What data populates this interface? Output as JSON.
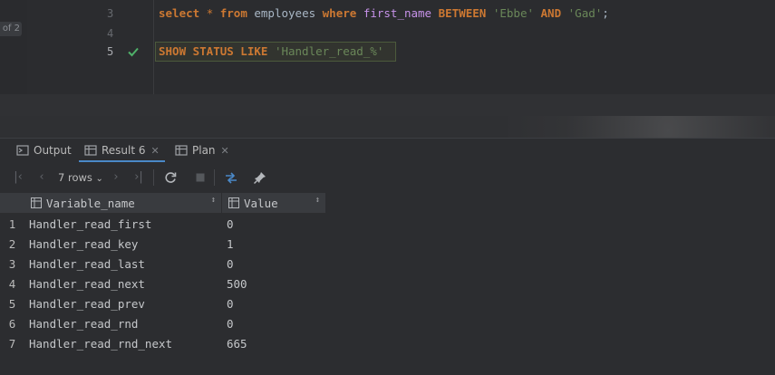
{
  "editor": {
    "page_indicator": "of 2",
    "lines": [
      {
        "num": "3",
        "tokens": [
          {
            "t": "select",
            "c": "kw"
          },
          {
            "t": " ",
            "c": "id"
          },
          {
            "t": "*",
            "c": "star"
          },
          {
            "t": " ",
            "c": "id"
          },
          {
            "t": "from",
            "c": "kw"
          },
          {
            "t": " employees ",
            "c": "id"
          },
          {
            "t": "where",
            "c": "kw"
          },
          {
            "t": " ",
            "c": "id"
          },
          {
            "t": "first_name",
            "c": "col"
          },
          {
            "t": " ",
            "c": "id"
          },
          {
            "t": "BETWEEN",
            "c": "kw"
          },
          {
            "t": " ",
            "c": "id"
          },
          {
            "t": "'Ebbe'",
            "c": "str"
          },
          {
            "t": " ",
            "c": "id"
          },
          {
            "t": "AND",
            "c": "kw"
          },
          {
            "t": " ",
            "c": "id"
          },
          {
            "t": "'Gad'",
            "c": "str"
          },
          {
            "t": ";",
            "c": "id"
          }
        ]
      },
      {
        "num": "4",
        "tokens": []
      },
      {
        "num": "5",
        "tokens": [
          {
            "t": "SHOW STATUS LIKE",
            "c": "kw"
          },
          {
            "t": " ",
            "c": "id"
          },
          {
            "t": "'Handler_read_%'",
            "c": "str"
          }
        ]
      }
    ]
  },
  "tool_window": {
    "tabs": [
      {
        "label": "Output",
        "icon": "output-icon",
        "closable": false,
        "selected": false
      },
      {
        "label": "Result 6",
        "icon": "table-icon",
        "closable": true,
        "selected": true
      },
      {
        "label": "Plan",
        "icon": "table-icon",
        "closable": true,
        "selected": false
      }
    ],
    "toolbar": {
      "rows_label": "7 rows",
      "rows_chevron": "⌄"
    }
  },
  "grid": {
    "columns": [
      "Variable_name",
      "Value"
    ],
    "sort_glyph": "↕",
    "rows": [
      {
        "n": "1",
        "name": "Handler_read_first",
        "value": "0"
      },
      {
        "n": "2",
        "name": "Handler_read_key",
        "value": "1"
      },
      {
        "n": "3",
        "name": "Handler_read_last",
        "value": "0"
      },
      {
        "n": "4",
        "name": "Handler_read_next",
        "value": "500"
      },
      {
        "n": "5",
        "name": "Handler_read_prev",
        "value": "0"
      },
      {
        "n": "6",
        "name": "Handler_read_rnd",
        "value": "0"
      },
      {
        "n": "7",
        "name": "Handler_read_rnd_next",
        "value": "665"
      }
    ]
  },
  "colors": {
    "keyword": "#cc7832",
    "string": "#6a8759",
    "column": "#c792ea",
    "selected_tab_underline": "#4a88c7",
    "success_check": "#4fb069"
  }
}
